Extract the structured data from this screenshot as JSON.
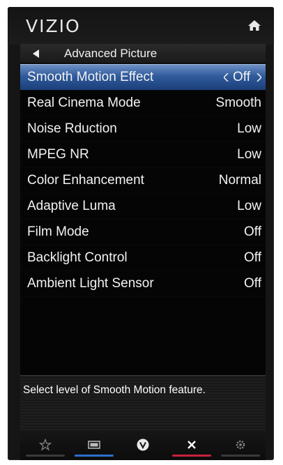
{
  "brand": {
    "logo_text": "VIZIO"
  },
  "header": {
    "title": "Advanced Picture"
  },
  "menu": {
    "items": [
      {
        "label": "Smooth Motion Effect",
        "value": "Off",
        "selected": true
      },
      {
        "label": "Real Cinema Mode",
        "value": "Smooth"
      },
      {
        "label": "Noise Rduction",
        "value": "Low"
      },
      {
        "label": "MPEG NR",
        "value": "Low"
      },
      {
        "label": "Color Enhancement",
        "value": "Normal"
      },
      {
        "label": "Adaptive Luma",
        "value": "Low"
      },
      {
        "label": "Film Mode",
        "value": "Off"
      },
      {
        "label": "Backlight Control",
        "value": "Off"
      },
      {
        "label": "Ambient Light Sensor",
        "value": "Off"
      }
    ]
  },
  "help": {
    "text": "Select level of Smooth Motion feature."
  },
  "nav": {
    "buttons": [
      {
        "icon": "star-icon",
        "accent": "#3a3a3a"
      },
      {
        "icon": "widescreen-icon",
        "accent": "#2f6fd0"
      },
      {
        "icon": "vizio-v-icon",
        "accent": "none"
      },
      {
        "icon": "close-icon",
        "accent": "#c8203d"
      },
      {
        "icon": "gear-icon",
        "accent": "#3a3a3a"
      }
    ]
  },
  "colors": {
    "selection_blue": "#2f5b9c",
    "background": "#050505",
    "text": "#f2f2f2"
  }
}
